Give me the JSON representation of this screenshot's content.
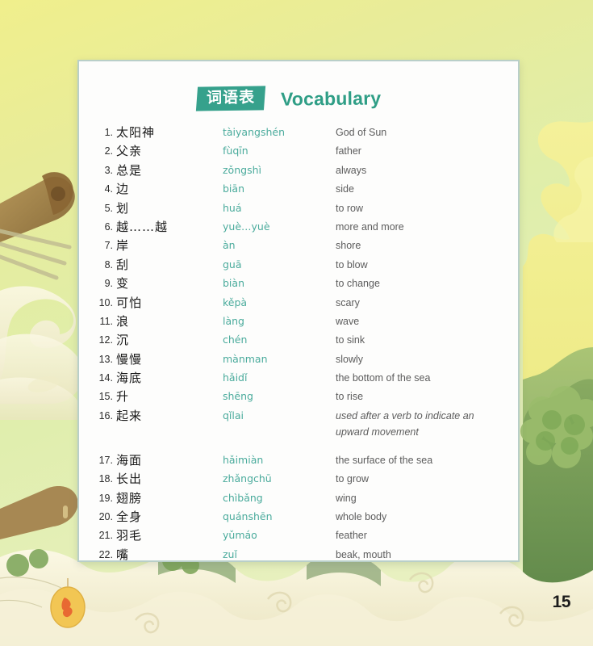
{
  "page": {
    "number": "15",
    "colors": {
      "badge_bg": "#36a18c",
      "title_en": "#2f9e86",
      "pinyin": "#4aab9c",
      "english": "#5c5c5c",
      "card_border": "#b9cfc9",
      "bg_top": "#eeee8f",
      "bg_bottom": "#e9f0c2",
      "wave_cream": "#f2eed2",
      "foliage_green": "#8fae63",
      "boat_brown": "#9c7a45",
      "seal_orange": "#e8622a"
    }
  },
  "header": {
    "badge_label": "词语表",
    "title_en": "Vocabulary"
  },
  "vocabulary": {
    "entries": [
      {
        "num": "1.",
        "hanzi": "太阳神",
        "pinyin": "tàiyangshén",
        "english": "God of Sun",
        "italic": false
      },
      {
        "num": "2.",
        "hanzi": "父亲",
        "pinyin": "fùqīn",
        "english": "father",
        "italic": false
      },
      {
        "num": "3.",
        "hanzi": "总是",
        "pinyin": "zǒngshì",
        "english": "always",
        "italic": false
      },
      {
        "num": "4.",
        "hanzi": "边",
        "pinyin": "biān",
        "english": "side",
        "italic": false
      },
      {
        "num": "5.",
        "hanzi": "划",
        "pinyin": "huá",
        "english": "to row",
        "italic": false
      },
      {
        "num": "6.",
        "hanzi": "越……越",
        "pinyin": "yuè…yuè",
        "english": "more and more",
        "italic": false
      },
      {
        "num": "7.",
        "hanzi": "岸",
        "pinyin": "àn",
        "english": "shore",
        "italic": false
      },
      {
        "num": "8.",
        "hanzi": "刮",
        "pinyin": "guā",
        "english": "to blow",
        "italic": false
      },
      {
        "num": "9.",
        "hanzi": "变",
        "pinyin": "biàn",
        "english": "to change",
        "italic": false
      },
      {
        "num": "10.",
        "hanzi": "可怕",
        "pinyin": "kěpà",
        "english": "scary",
        "italic": false
      },
      {
        "num": "11.",
        "hanzi": "浪",
        "pinyin": "làng",
        "english": "wave",
        "italic": false
      },
      {
        "num": "12.",
        "hanzi": "沉",
        "pinyin": "chén",
        "english": "to sink",
        "italic": false
      },
      {
        "num": "13.",
        "hanzi": "慢慢",
        "pinyin": "mànman",
        "english": "slowly",
        "italic": false
      },
      {
        "num": "14.",
        "hanzi": "海底",
        "pinyin": "hǎidǐ",
        "english": "the bottom of the sea",
        "italic": false
      },
      {
        "num": "15.",
        "hanzi": "升",
        "pinyin": "shēng",
        "english": "to rise",
        "italic": false
      },
      {
        "num": "16.",
        "hanzi": "起来",
        "pinyin": "qǐlai",
        "english": "used after a verb to indicate an upward movement",
        "italic": true
      },
      {
        "num": "17.",
        "hanzi": "海面",
        "pinyin": "hǎimiàn",
        "english": "the surface of the sea",
        "italic": false
      },
      {
        "num": "18.",
        "hanzi": "长出",
        "pinyin": "zhǎngchū",
        "english": "to grow",
        "italic": false
      },
      {
        "num": "19.",
        "hanzi": "翅膀",
        "pinyin": "chìbǎng",
        "english": "wing",
        "italic": false
      },
      {
        "num": "20.",
        "hanzi": "全身",
        "pinyin": "quánshēn",
        "english": "whole body",
        "italic": false
      },
      {
        "num": "21.",
        "hanzi": "羽毛",
        "pinyin": "yǔmáo",
        "english": "feather",
        "italic": false
      },
      {
        "num": "22.",
        "hanzi": "嘴",
        "pinyin": "zuǐ",
        "english": "beak, mouth",
        "italic": false
      }
    ]
  }
}
